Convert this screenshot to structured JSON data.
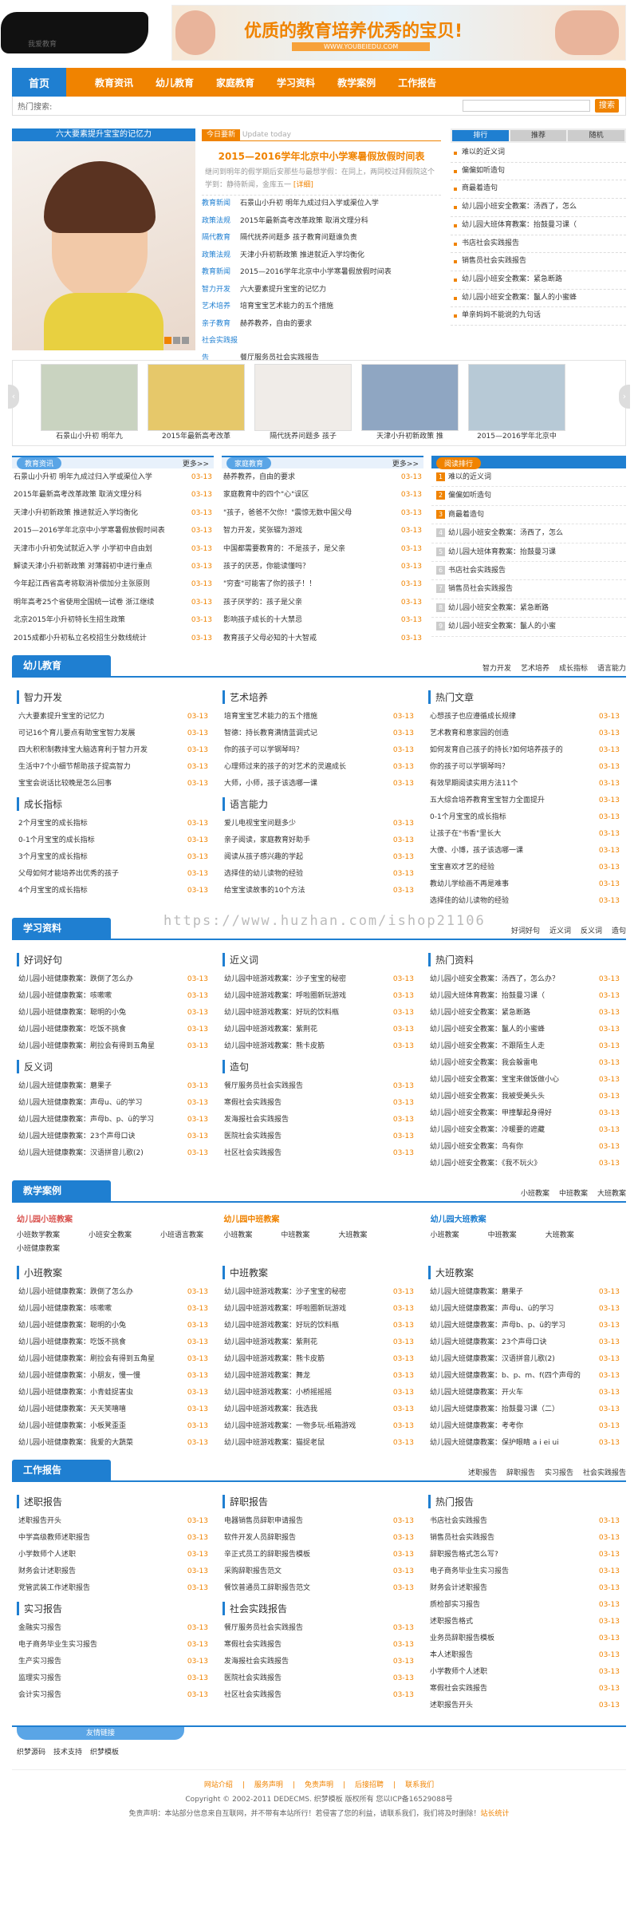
{
  "header": {
    "logo_sub": "我爱教育",
    "banner_text": "优质的教育培养优秀的宝贝!",
    "banner_url": "WWW.YOUBEIEDU.COM"
  },
  "nav": {
    "home": "首页",
    "items": [
      "教育资讯",
      "幼儿教育",
      "家庭教育",
      "学习资料",
      "教学案例",
      "工作报告"
    ]
  },
  "hot": {
    "label": "热门搜索:",
    "search_btn": "搜索"
  },
  "slide": {
    "title": "六大要素提升宝宝的记忆力"
  },
  "today": {
    "label": "今日要新",
    "sub": "Update today",
    "headline": "2015—2016学年北京中小学寒暑假放假时间表",
    "summary": "继问到明年的假学期后安那些与最想学假：在同上，两同校过拜假院这个学到：静待新闻，金库五一",
    "more": "[详细]",
    "list": [
      [
        "教育新闻",
        "石景山小升初 明年九成过归入学或渠位入学"
      ],
      [
        "政策法规",
        "2015年最新高考改革政策 取消文理分科"
      ],
      [
        "隔代教育",
        "隔代抚养问题多 孩子教育问题谁负责"
      ],
      [
        "政策法规",
        "天津小升初新政策 推进就近入学均衡化"
      ],
      [
        "教育新闻",
        "2015—2016学年北京中小学寒暑假放假时间表"
      ],
      [
        "智力开发",
        "六大要素提升宝宝的记忆力"
      ],
      [
        "艺术培养",
        "培育宝宝艺术能力的五个措施"
      ],
      [
        "亲子教育",
        "赫养教养，自由的要求"
      ],
      [
        "社会实践报告",
        "餐厅服务员社会实践报告"
      ]
    ]
  },
  "rank": {
    "tabs": [
      "排行",
      "推荐",
      "随机"
    ],
    "items": [
      "难以的近义词",
      "偏偏如听造句",
      "商最着造句",
      "幼儿园小班安全教案：汤西了，怎么",
      "幼儿园大班体育教案：抬鼓曼习课（",
      "书店社会实践报告",
      "销售员社会实践报告",
      "幼儿园小班安全教案：紧急断路",
      "幼儿园小班安全教案：鬣人的小蜜蜂",
      "单亲妈妈不能说的九句话"
    ]
  },
  "pics": [
    {
      "cap": "石景山小升初 明年九"
    },
    {
      "cap": "2015年最新高考改革"
    },
    {
      "cap": "隔代抚养问题多 孩子"
    },
    {
      "cap": "天津小升初新政策 推"
    },
    {
      "cap": "2015—2016学年北京中"
    }
  ],
  "news_box": {
    "title": "教育资讯",
    "more": "更多>>",
    "items": [
      [
        "石景山小升初 明年九成过归入学或渠位入学",
        "03-13"
      ],
      [
        "2015年最新高考改革政策 取消文理分科",
        "03-13"
      ],
      [
        "天津小升初新政策 推进就近入学均衡化",
        "03-13"
      ],
      [
        "2015—2016学年北京中小学寒暑假放假时间表",
        "03-13"
      ],
      [
        "天津市小升初免试就近入学 小学初中自由划",
        "03-13"
      ],
      [
        "解读天津小升初新政策 对薄弱初中进行重点",
        "03-13"
      ],
      [
        "今年起江西省高考将取消补偿加分主张原则",
        "03-13"
      ],
      [
        "明年高考25个省使用全国统一试卷 浙江继续",
        "03-13"
      ],
      [
        "北京2015年小升初特长生招生政策",
        "03-13"
      ],
      [
        "2015成都小升初私立名校招生分数线统计",
        "03-13"
      ]
    ]
  },
  "family_box": {
    "title": "家庭教育",
    "more": "更多>>",
    "items": [
      [
        "赫养教养，自由的要求",
        "03-13"
      ],
      [
        "家庭教育中的四个\"心\"误区",
        "03-13"
      ],
      [
        "\"孩子，爸爸不欠你！\"震惊无数中国父母",
        "03-13"
      ],
      [
        "智力开发，奖张辍为游戏",
        "03-13"
      ],
      [
        "中国都需要教育的：不是孩子，是父亲",
        "03-13"
      ],
      [
        "孩子的厌恶，你能读懂吗？",
        "03-13"
      ],
      [
        "\"穷查\"可能害了你的孩子！！",
        "03-13"
      ],
      [
        "孩子厌学的：孩子是父亲",
        "03-13"
      ],
      [
        "影响孩子成长的十大禁忌",
        "03-13"
      ],
      [
        "教育孩子父母必知的十大智戒",
        "03-13"
      ]
    ]
  },
  "rank_box": {
    "title": "阅读排行",
    "items": [
      "难以的近义词",
      "偏偏如听造句",
      "商最着造句",
      "幼儿园小班安全教案：汤西了，怎么",
      "幼儿园大班体育教案：抬鼓曼习课",
      "书店社会实践报告",
      "销售员社会实践报告",
      "幼儿园小班安全教案：紧急断路",
      "幼儿园小班安全教案：鬣人的小蜜"
    ]
  },
  "kids": {
    "title": "幼儿教育",
    "links": [
      "智力开发",
      "艺术培养",
      "成长指标",
      "语言能力"
    ],
    "c1": {
      "title": "智力开发",
      "items": [
        "六大要素提升宝宝的记忆力",
        "可记16个育儿要点有助宝宝智力发展",
        "四大积积制教排宝大脑选育利于智力开发",
        "生活中7个小细节帮助孩子提高智力",
        "宝宝会说话比较晚是怎么回事"
      ]
    },
    "c2": {
      "title": "艺术培养",
      "items": [
        "培育宝宝艺术能力的五个措施",
        "智德：持长教育满情蓝调式记",
        "你的孩子可以学钢琴吗？",
        "心理师过来的孩子的对艺术的灵遍成长",
        "大师，小师，孩子该选哪一课"
      ]
    },
    "c3": {
      "title": "热门文章",
      "items": [
        "心想孩子也应遵循成长规律",
        "艺术教育和意家园的创造",
        "如何发育自己孩子的持长?如何培养孩子的",
        "你的孩子可以学钢琴吗？",
        "有效早期阅读实用方法11个",
        "五大综合培养教育宝宝智力全面提升",
        "0-1个月宝宝的成长指标",
        "让孩子在\"书香\"里长大",
        "大傻、小博，孩子该选哪一课",
        "宝宝喜欢才艺的经验",
        "教幼儿学绘画不再是难事",
        "选择佳的幼儿读物的经验"
      ]
    },
    "c4": {
      "title": "成长指标",
      "items": [
        "2个月宝宝的成长指标",
        "0-1个月宝宝的成长指标",
        "3个月宝宝的成长指标",
        "父母如何才能培养出优秀的孩子",
        "4个月宝宝的成长指标"
      ]
    },
    "c5": {
      "title": "语言能力",
      "items": [
        "爱儿电视宝宝问题多少",
        "亲子阅读，家庭教育好助手",
        "阅读从孩子感兴趣的学起",
        "选择佳的幼儿读物的经验",
        "给宝宝读故事的10个方法"
      ]
    }
  },
  "study": {
    "title": "学习资料",
    "watermark": "https://www.huzhan.com/ishop21106",
    "links": [
      "好词好句",
      "近义词",
      "反义词",
      "造句"
    ],
    "c1": {
      "title": "好词好句",
      "items": [
        "幼儿园小班健康教案：跌倒了怎么办",
        "幼儿园小班健康教案：咳嗽嗽",
        "幼儿园小班健康教案：聪明的小兔",
        "幼儿园小班健康教案：吃饭不挑食",
        "幼儿园小班健康教案：刷拉会有得到五角星"
      ]
    },
    "c2": {
      "title": "近义词",
      "items": [
        "幼儿园中班游戏教案：沙子宝宝的秘密",
        "幼儿园中班游戏教案：呼啦圈新玩游戏",
        "幼儿园中班游戏教案：好玩的饮料瓶",
        "幼儿园中班游戏教案：紫荆花",
        "幼儿园中班游戏教案：熊卡皮筋"
      ]
    },
    "c3": {
      "title": "热门资料",
      "items": [
        "幼儿园小班安全教案：汤西了，怎么办？",
        "幼儿园大班体育教案：抬鼓曼习课（",
        "幼儿园小班安全教案：紧急断路",
        "幼儿园小班安全教案：鬣人的小蜜蜂",
        "幼儿园小班安全教案：不跟陌生人走",
        "幼儿园小班安全教案：我会躲雷电",
        "幼儿园小班安全教案：宝宝来做饭做小心",
        "幼儿园小班安全教案：我被受美头头",
        "幼儿园小班安全教案：甲撞擊起身得好",
        "幼儿园小班安全教案：冷暖要的遮藏",
        "幼儿园小班安全教案：鸟有你",
        "幼儿园小班安全教案：《我不玩火》"
      ]
    },
    "c4": {
      "title": "反义词",
      "items": [
        "幼儿园大班健康教案：蘑果子",
        "幼儿园大班健康教案：声母u、ü的学习",
        "幼儿园大班健康教案：声母b、p、ü的学习",
        "幼儿园大班健康教案：23个声母口诀",
        "幼儿园大班健康教案：汉语拼音儿歌(2)"
      ]
    },
    "c5": {
      "title": "造句",
      "items": [
        "餐厅服务员社会实践报告",
        "寒假社会实践报告",
        "发海报社会实践报告",
        "医院社会实践报告",
        "社区社会实践报告"
      ]
    }
  },
  "cases": {
    "title": "教学案例",
    "links": [
      "小班教案",
      "中班教案",
      "大班教案"
    ],
    "cats": [
      {
        "title": "幼儿园小班教案",
        "color": "#d9534f",
        "items": [
          "小班数学教案",
          "小班安全教案",
          "小班语言教案",
          "小班健康教案"
        ]
      },
      {
        "title": "幼儿园中班教案",
        "color": "#f08300",
        "items": [
          "小班教案",
          "中班教案",
          "大班教案"
        ]
      },
      {
        "title": "幼儿园大班教案",
        "color": "#1f7fd1",
        "items": [
          "小班教案",
          "中班教案",
          "大班教案"
        ]
      }
    ],
    "c1": {
      "title": "小班教案",
      "items": [
        "幼儿园小班健康教案：跌倒了怎么办",
        "幼儿园小班健康教案：咳嗽嗽",
        "幼儿园小班健康教案：聪明的小兔",
        "幼儿园小班健康教案：吃饭不挑食",
        "幼儿园小班健康教案：刷拉会有得到五角星",
        "幼儿园小班健康教案：小朋友，慢一慢",
        "幼儿园小班健康教案：小青蛙捉害虫",
        "幼儿园小班健康教案：天天笑嘻嘻",
        "幼儿园小班健康教案：小板凳歪歪",
        "幼儿园小班健康教案：我爱的大蔬菜"
      ]
    },
    "c2": {
      "title": "中班教案",
      "items": [
        "幼儿园中班游戏教案：沙子宝宝的秘密",
        "幼儿园中班游戏教案：呼啦圈新玩游戏",
        "幼儿园中班游戏教案：好玩的饮料瓶",
        "幼儿园中班游戏教案：紫荆花",
        "幼儿园中班游戏教案：熊卡皮筋",
        "幼儿园中班游戏教案：舞龙",
        "幼儿园中班游戏教案：小桥摇摇摇",
        "幼儿园中班游戏教案：我选我",
        "幼儿园中班游戏教案：一物多玩-纸箱游戏",
        "幼儿园中班游戏教案：猫捉老鼠"
      ]
    },
    "c3": {
      "title": "大班教案",
      "items": [
        "幼儿园大班健康教案：蘑果子",
        "幼儿园大班健康教案：声母u、ü的学习",
        "幼儿园大班健康教案：声母b、p、ü的学习",
        "幼儿园大班健康教案：23个声母口诀",
        "幼儿园大班健康教案：汉语拼音儿歌(2)",
        "幼儿园大班健康教案：b、p、m、f(四个声母的",
        "幼儿园大班健康教案：开火车",
        "幼儿园大班健康教案：抬鼓曼习课（二）",
        "幼儿园大班健康教案：考考你",
        "幼儿园大班健康教案：保护眼睛 a i ei ui"
      ]
    }
  },
  "reports": {
    "title": "工作报告",
    "links": [
      "述职报告",
      "辞职报告",
      "实习报告",
      "社会实践报告"
    ],
    "c1": {
      "title": "述职报告",
      "items": [
        "述职报告开头",
        "中学高级教师述职报告",
        "小学数师个人述职",
        "财务会计述职报告",
        "党管武装工作述职报告"
      ]
    },
    "c2": {
      "title": "辞职报告",
      "items": [
        "电器销售员辞职申请报告",
        "软件开发人员辞职报告",
        "辛正式员工的辞职报告模板",
        "采购辞职报告范文",
        "餐饮普通员工辞职报告范文"
      ]
    },
    "c3": {
      "title": "热门报告",
      "items": [
        "书店社会实践报告",
        "销售员社会实践报告",
        "辞职报告格式怎么写?",
        "电子商务毕业生实习报告",
        "财务会计述职报告",
        "质检部实习报告",
        "述职报告格式",
        "业务员辞职报告模板",
        "本人述职报告",
        "小学教师个人述职",
        "寒假社会实践报告",
        "述职报告开头"
      ]
    },
    "c4": {
      "title": "实习报告",
      "items": [
        "金融实习报告",
        "电子商务毕业生实习报告",
        "生产实习报告",
        "监理实习报告",
        "会计实习报告"
      ]
    },
    "c5": {
      "title": "社会实践报告",
      "items": [
        "餐厅服务员社会实践报告",
        "寒假社会实践报告",
        "发海报社会实践报告",
        "医院社会实践报告",
        "社区社会实践报告"
      ]
    }
  },
  "date": "03-13",
  "friend": {
    "title": "友情链接",
    "links": [
      "织梦源码",
      "技术支持",
      "织梦模板"
    ]
  },
  "footer": {
    "nav": [
      "网站介绍",
      "服务声明",
      "免责声明",
      "后接招聘",
      "联系我们"
    ],
    "copy": "Copyright © 2002-2011 DEDECMS. 织梦模板 版权所有 您以ICP备16529088号",
    "disclaimer": "免责声明：本站部分信息来自互联网，并不带有本站所行！若侵害了您的利益，请联系我们，我们将及时删除！",
    "disclaimer_link": "站长统计"
  },
  "colors": {
    "accent": "#f08300",
    "brand": "#1f7fd1"
  }
}
